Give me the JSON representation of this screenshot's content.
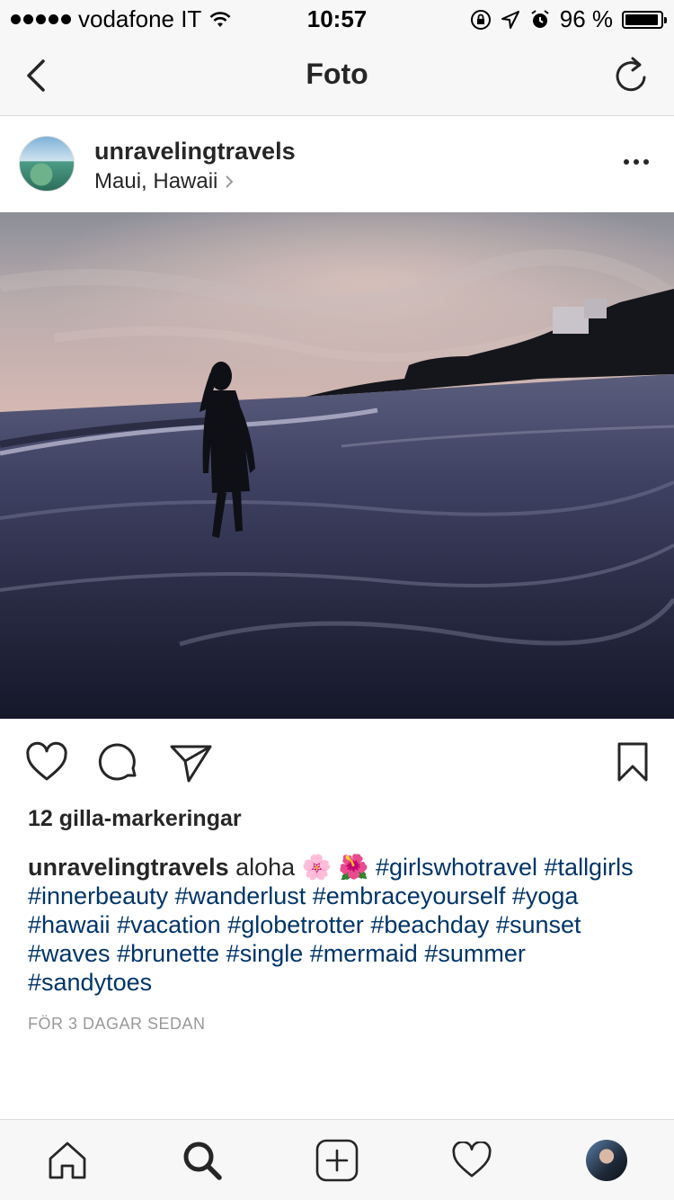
{
  "status_bar": {
    "carrier": "vodafone IT",
    "time": "10:57",
    "battery_percent": "96 %",
    "battery_level": 0.96,
    "signal_icon": "signal-dots-icon",
    "wifi_icon": "wifi-icon"
  },
  "navbar": {
    "title": "Foto",
    "back_icon": "chevron-left-icon",
    "refresh_icon": "refresh-icon"
  },
  "post": {
    "username": "unravelingtravels",
    "location": "Maui, Hawaii",
    "likes": "12 gilla-markeringar",
    "caption_text": "aloha 🌸 🌺",
    "hashtags": [
      "#girlswhotravel",
      "#tallgirls",
      "#innerbeauty",
      "#wanderlust",
      "#embraceyourself",
      "#yoga",
      "#hawaii",
      "#vacation",
      "#globetrotter",
      "#beachday",
      "#sunset",
      "#waves",
      "#brunette",
      "#single",
      "#mermaid",
      "#summer",
      "#sandytoes"
    ],
    "time_ago": "FÖR 3 DAGAR SEDAN"
  },
  "colors": {
    "hashtag": "#003569",
    "text": "#262626",
    "muted": "#999999",
    "bar_bg": "#f7f7f7"
  }
}
